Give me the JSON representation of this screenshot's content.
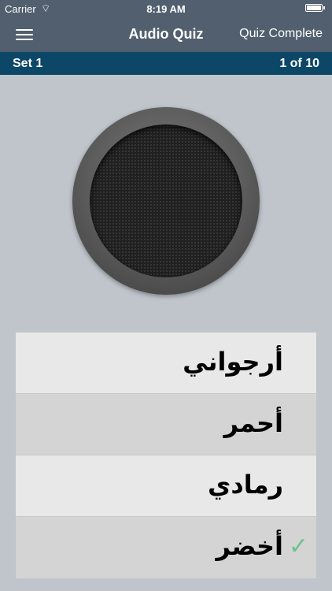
{
  "status": {
    "carrier": "Carrier",
    "time": "8:19 AM"
  },
  "nav": {
    "title": "Audio Quiz",
    "right_action": "Quiz Complete"
  },
  "set": {
    "label": "Set 1",
    "progress": "1 of 10"
  },
  "answers": [
    {
      "text": "أرجواني",
      "correct": false
    },
    {
      "text": "أحمر",
      "correct": false
    },
    {
      "text": "رمادي",
      "correct": false
    },
    {
      "text": "أخضر",
      "correct": true,
      "check": "✓"
    }
  ],
  "colors": {
    "accent": "#0c4767",
    "navbar": "#515f6e",
    "check": "#6fc28d"
  },
  "icons": {
    "wifi": "◜",
    "menu": "menu-icon",
    "check": "checkmark-icon"
  }
}
